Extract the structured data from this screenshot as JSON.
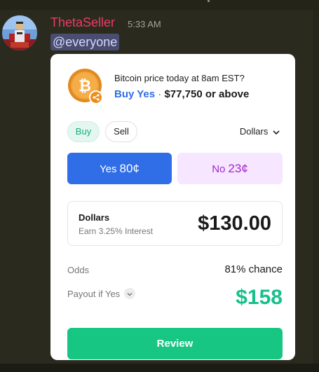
{
  "message": {
    "username": "ThetaSeller",
    "timestamp": "5:33 AM",
    "mention": "@everyone"
  },
  "card": {
    "question": "Bitcoin price today at 8am EST?",
    "buy_yes_label": "Buy Yes",
    "separator": "·",
    "threshold": "$77,750 or above",
    "tabs": {
      "buy": "Buy",
      "sell": "Sell"
    },
    "currency_select": "Dollars",
    "yes": {
      "label": "Yes",
      "price": "80¢"
    },
    "no": {
      "label": "No",
      "price": "23¢"
    },
    "amount_box": {
      "label": "Dollars",
      "interest": "Earn 3.25% Interest",
      "value": "$130.00"
    },
    "odds": {
      "label": "Odds",
      "value": "81% chance"
    },
    "payout": {
      "label": "Payout if Yes",
      "value": "$158"
    },
    "review_label": "Review"
  },
  "colors": {
    "background": "#2b2a1f",
    "username": "#ea3d64",
    "yes_blue": "#2f6ee7",
    "no_purple": "#a324cf",
    "green": "#16c682"
  },
  "icons": {
    "coin": "bitcoin-icon",
    "coin_badge": "share-icon",
    "dropdown": "chevron-down-icon"
  }
}
